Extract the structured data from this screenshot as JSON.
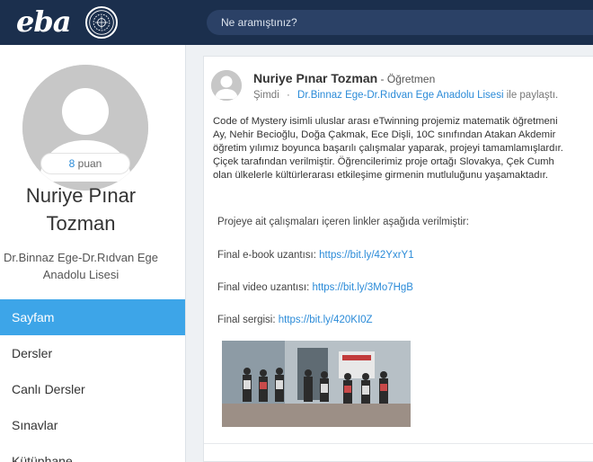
{
  "header": {
    "logo_text": "eba",
    "search_placeholder": "Ne aramıştınız?"
  },
  "profile": {
    "points_value": "8",
    "points_label": "puan",
    "name": "Nuriye Pınar Tozman",
    "school": "Dr.Binnaz Ege-Dr.Rıdvan Ege Anadolu Lisesi"
  },
  "menu": {
    "items": [
      {
        "label": "Sayfam",
        "active": true
      },
      {
        "label": "Dersler"
      },
      {
        "label": "Canlı Dersler"
      },
      {
        "label": "Sınavlar"
      },
      {
        "label": "Kütüphane"
      }
    ]
  },
  "post": {
    "author": "Nuriye Pınar Tozman",
    "role": " - Öğretmen",
    "time": "Şimdi",
    "separator": "·",
    "school_link": "Dr.Binnaz Ege-Dr.Rıdvan Ege Anadolu Lisesi",
    "share_text": " ile paylaştı.",
    "body_lines": [
      "Code of Mystery isimli uluslar arası eTwinning projemiz matematik öğretmeni",
      "Ay, Nehir Becioğlu, Doğa Çakmak, Ece Dişli, 10C sınıfından Atakan Akdemir",
      "öğretim yılımız boyunca başarılı çalışmalar yaparak, projeyi tamamlamışlardır.",
      "Çiçek tarafından verilmiştir. Öğrencilerimiz proje ortağı  Slovakya, Çek Cumh",
      "olan ülkelerle kültürlerarası etkileşime girmenin mutluluğunu yaşamaktadır."
    ],
    "links_intro": "Projeye ait çalışmaları içeren linkler aşağıda verilmiştir:",
    "ebook_label": "Final e-book uzantısı: ",
    "ebook_url": "https://bit.ly/42YxrY1",
    "video_label": "Final video uzantısı: ",
    "video_url": "https://bit.ly/3Mo7HgB",
    "exhibit_label": "Final sergisi: ",
    "exhibit_url": "https://bit.ly/420KI0Z"
  },
  "colors": {
    "header_bg": "#1b2f4d",
    "accent": "#3da5e8",
    "link": "#2b8bd8"
  }
}
